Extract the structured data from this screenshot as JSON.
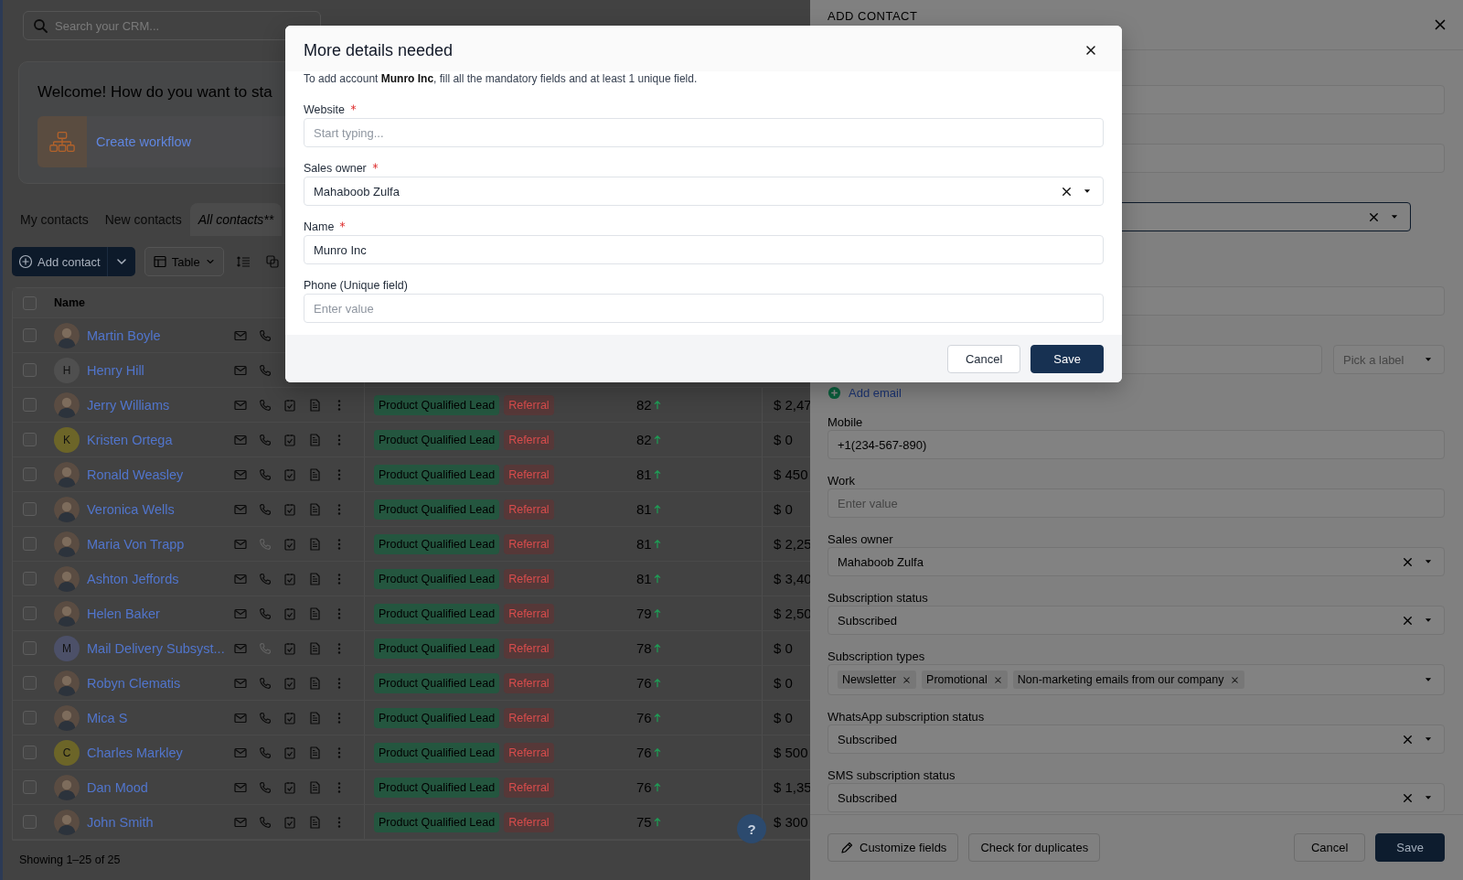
{
  "search": {
    "placeholder": "Search your CRM..."
  },
  "welcome": {
    "title": "Welcome! How do you want to sta",
    "actions": [
      {
        "label": "Create workflow"
      }
    ]
  },
  "tabs": [
    {
      "label": "My contacts",
      "selected": false
    },
    {
      "label": "New contacts",
      "selected": false
    },
    {
      "label": "All contacts**",
      "selected": true
    }
  ],
  "toolbar": {
    "add_button": "Add contact",
    "view_select": "Table"
  },
  "table": {
    "columns": [
      "Name"
    ],
    "select_all": {
      "checked": false
    },
    "rows": [
      {
        "checked": false,
        "name": "Martin Boyle",
        "avatar": {
          "kind": "photo"
        },
        "phone_disabled": false
      },
      {
        "checked": false,
        "name": "Henry Hill",
        "avatar": {
          "kind": "initial",
          "initial": "H",
          "color": "#4f4f4f"
        },
        "phone_disabled": false
      },
      {
        "checked": false,
        "name": "Jerry Williams",
        "avatar": {
          "kind": "photo"
        },
        "phone_disabled": false,
        "tags": [
          {
            "label": "Product Qualified Lead",
            "kind": "lifecycle",
            "color": "#24563f"
          },
          {
            "label": "Referral",
            "kind": "source",
            "color": "#563838"
          }
        ],
        "score": "82",
        "amount": "$ 2,47"
      },
      {
        "checked": false,
        "name": "Kristen Ortega",
        "avatar": {
          "kind": "initial",
          "initial": "K",
          "color": "#6c6528"
        },
        "phone_disabled": false,
        "tags": [
          {
            "label": "Product Qualified Lead",
            "kind": "lifecycle",
            "color": "#24563f"
          },
          {
            "label": "Referral",
            "kind": "source",
            "color": "#563838"
          }
        ],
        "score": "82",
        "amount": "$ 0"
      },
      {
        "checked": false,
        "name": "Ronald Weasley",
        "avatar": {
          "kind": "photo"
        },
        "phone_disabled": false,
        "tags": [
          {
            "label": "Product Qualified Lead",
            "kind": "lifecycle",
            "color": "#24563f"
          },
          {
            "label": "Referral",
            "kind": "source",
            "color": "#563838"
          }
        ],
        "score": "81",
        "amount": "$ 450"
      },
      {
        "checked": false,
        "name": "Veronica Wells",
        "avatar": {
          "kind": "photo"
        },
        "phone_disabled": false,
        "tags": [
          {
            "label": "Product Qualified Lead",
            "kind": "lifecycle",
            "color": "#24563f"
          },
          {
            "label": "Referral",
            "kind": "source",
            "color": "#563838"
          }
        ],
        "score": "81",
        "amount": "$ 0"
      },
      {
        "checked": false,
        "name": "Maria Von Trapp",
        "avatar": {
          "kind": "photo"
        },
        "phone_disabled": true,
        "tags": [
          {
            "label": "Product Qualified Lead",
            "kind": "lifecycle",
            "color": "#24563f"
          },
          {
            "label": "Referral",
            "kind": "source",
            "color": "#563838"
          }
        ],
        "score": "81",
        "amount": "$ 2,25"
      },
      {
        "checked": false,
        "name": "Ashton Jeffords",
        "avatar": {
          "kind": "photo"
        },
        "phone_disabled": false,
        "tags": [
          {
            "label": "Product Qualified Lead",
            "kind": "lifecycle",
            "color": "#24563f"
          },
          {
            "label": "Referral",
            "kind": "source",
            "color": "#563838"
          }
        ],
        "score": "81",
        "amount": "$ 3,40"
      },
      {
        "checked": false,
        "name": "Helen Baker",
        "avatar": {
          "kind": "photo"
        },
        "phone_disabled": false,
        "tags": [
          {
            "label": "Product Qualified Lead",
            "kind": "lifecycle",
            "color": "#24563f"
          },
          {
            "label": "Referral",
            "kind": "source",
            "color": "#563838"
          }
        ],
        "score": "79",
        "amount": "$ 2,50"
      },
      {
        "checked": false,
        "name": "Mail Delivery Subsyst...",
        "avatar": {
          "kind": "initial",
          "initial": "M",
          "color": "#4c5068"
        },
        "phone_disabled": true,
        "tags": [
          {
            "label": "Product Qualified Lead",
            "kind": "lifecycle",
            "color": "#24563f"
          },
          {
            "label": "Referral",
            "kind": "source",
            "color": "#563838"
          }
        ],
        "score": "78",
        "amount": "$ 0"
      },
      {
        "checked": false,
        "name": "Robyn Clematis",
        "avatar": {
          "kind": "photo"
        },
        "phone_disabled": false,
        "tags": [
          {
            "label": "Product Qualified Lead",
            "kind": "lifecycle",
            "color": "#24563f"
          },
          {
            "label": "Referral",
            "kind": "source",
            "color": "#563838"
          }
        ],
        "score": "76",
        "amount": "$ 0"
      },
      {
        "checked": false,
        "name": "Mica S",
        "avatar": {
          "kind": "photo"
        },
        "phone_disabled": false,
        "tags": [
          {
            "label": "Product Qualified Lead",
            "kind": "lifecycle",
            "color": "#24563f"
          },
          {
            "label": "Referral",
            "kind": "source",
            "color": "#563838"
          }
        ],
        "score": "76",
        "amount": "$ 0"
      },
      {
        "checked": false,
        "name": "Charles Markley",
        "avatar": {
          "kind": "initial",
          "initial": "C",
          "color": "#6c6528"
        },
        "phone_disabled": false,
        "tags": [
          {
            "label": "Product Qualified Lead",
            "kind": "lifecycle",
            "color": "#24563f"
          },
          {
            "label": "Referral",
            "kind": "source",
            "color": "#563838"
          }
        ],
        "score": "76",
        "amount": "$ 500"
      },
      {
        "checked": false,
        "name": "Dan Mood",
        "avatar": {
          "kind": "photo"
        },
        "phone_disabled": false,
        "tags": [
          {
            "label": "Product Qualified Lead",
            "kind": "lifecycle",
            "color": "#24563f"
          },
          {
            "label": "Referral",
            "kind": "source",
            "color": "#563838"
          }
        ],
        "score": "76",
        "amount": "$ 1,35"
      },
      {
        "checked": false,
        "name": "John Smith",
        "avatar": {
          "kind": "photo"
        },
        "phone_disabled": false,
        "tags": [
          {
            "label": "Product Qualified Lead",
            "kind": "lifecycle",
            "color": "#24563f"
          },
          {
            "label": "Referral",
            "kind": "source",
            "color": "#563838"
          }
        ],
        "score": "75",
        "amount": "$ 300"
      }
    ]
  },
  "footer": {
    "summary": "Showing 1–25 of 25"
  },
  "help_button": "?",
  "drawer": {
    "title": "ADD CONTACT",
    "fields": [
      {
        "kind": "input"
      },
      {
        "kind": "input"
      },
      {
        "kind": "select",
        "focused": true,
        "clearable": true
      },
      {
        "kind": "input"
      },
      {
        "kind": "email",
        "label_picker": "Pick a label"
      },
      {
        "kind": "link",
        "label": "Add email"
      },
      {
        "kind": "input",
        "label": "Mobile",
        "value": "+1(234-567-890)"
      },
      {
        "kind": "input",
        "label": "Work",
        "placeholder": "Enter value"
      },
      {
        "kind": "select",
        "label": "Sales owner",
        "value": "Mahaboob Zulfa",
        "focused": false,
        "clearable": true
      },
      {
        "kind": "select",
        "label": "Subscription status",
        "value": "Subscribed",
        "focused": false,
        "clearable": true
      },
      {
        "kind": "tags",
        "label": "Subscription types",
        "tags": [
          "Newsletter",
          "Promotional",
          "Non-marketing emails from our company"
        ]
      },
      {
        "kind": "select",
        "label": "WhatsApp subscription status",
        "value": "Subscribed",
        "focused": false,
        "clearable": true
      },
      {
        "kind": "select",
        "label": "SMS subscription status",
        "value": "Subscribed",
        "focused": false,
        "clearable": true
      }
    ],
    "buttons": [
      {
        "label": "Customize fields",
        "kind": "edit"
      },
      {
        "label": "Check for duplicates",
        "kind": "secondary"
      },
      {
        "label": "Cancel",
        "kind": "cancel"
      },
      {
        "label": "Save",
        "kind": "primary"
      }
    ]
  },
  "modal": {
    "title": "More details needed",
    "description": "To add account **Munro Inc**, fill all the mandatory fields and at least 1 unique field.",
    "fields": [
      {
        "label": "Website",
        "required": true,
        "kind": "input",
        "placeholder": "Start typing..."
      },
      {
        "label": "Sales owner",
        "required": true,
        "kind": "select",
        "value": "Mahaboob Zulfa",
        "clearable": true
      },
      {
        "label": "Name",
        "required": true,
        "kind": "input",
        "value": "Munro Inc"
      },
      {
        "label": "Phone (Unique field)",
        "required": false,
        "kind": "input",
        "placeholder": "Enter value"
      }
    ],
    "buttons": [
      {
        "label": "Cancel",
        "kind": "secondary"
      },
      {
        "label": "Save",
        "kind": "primary"
      }
    ]
  }
}
